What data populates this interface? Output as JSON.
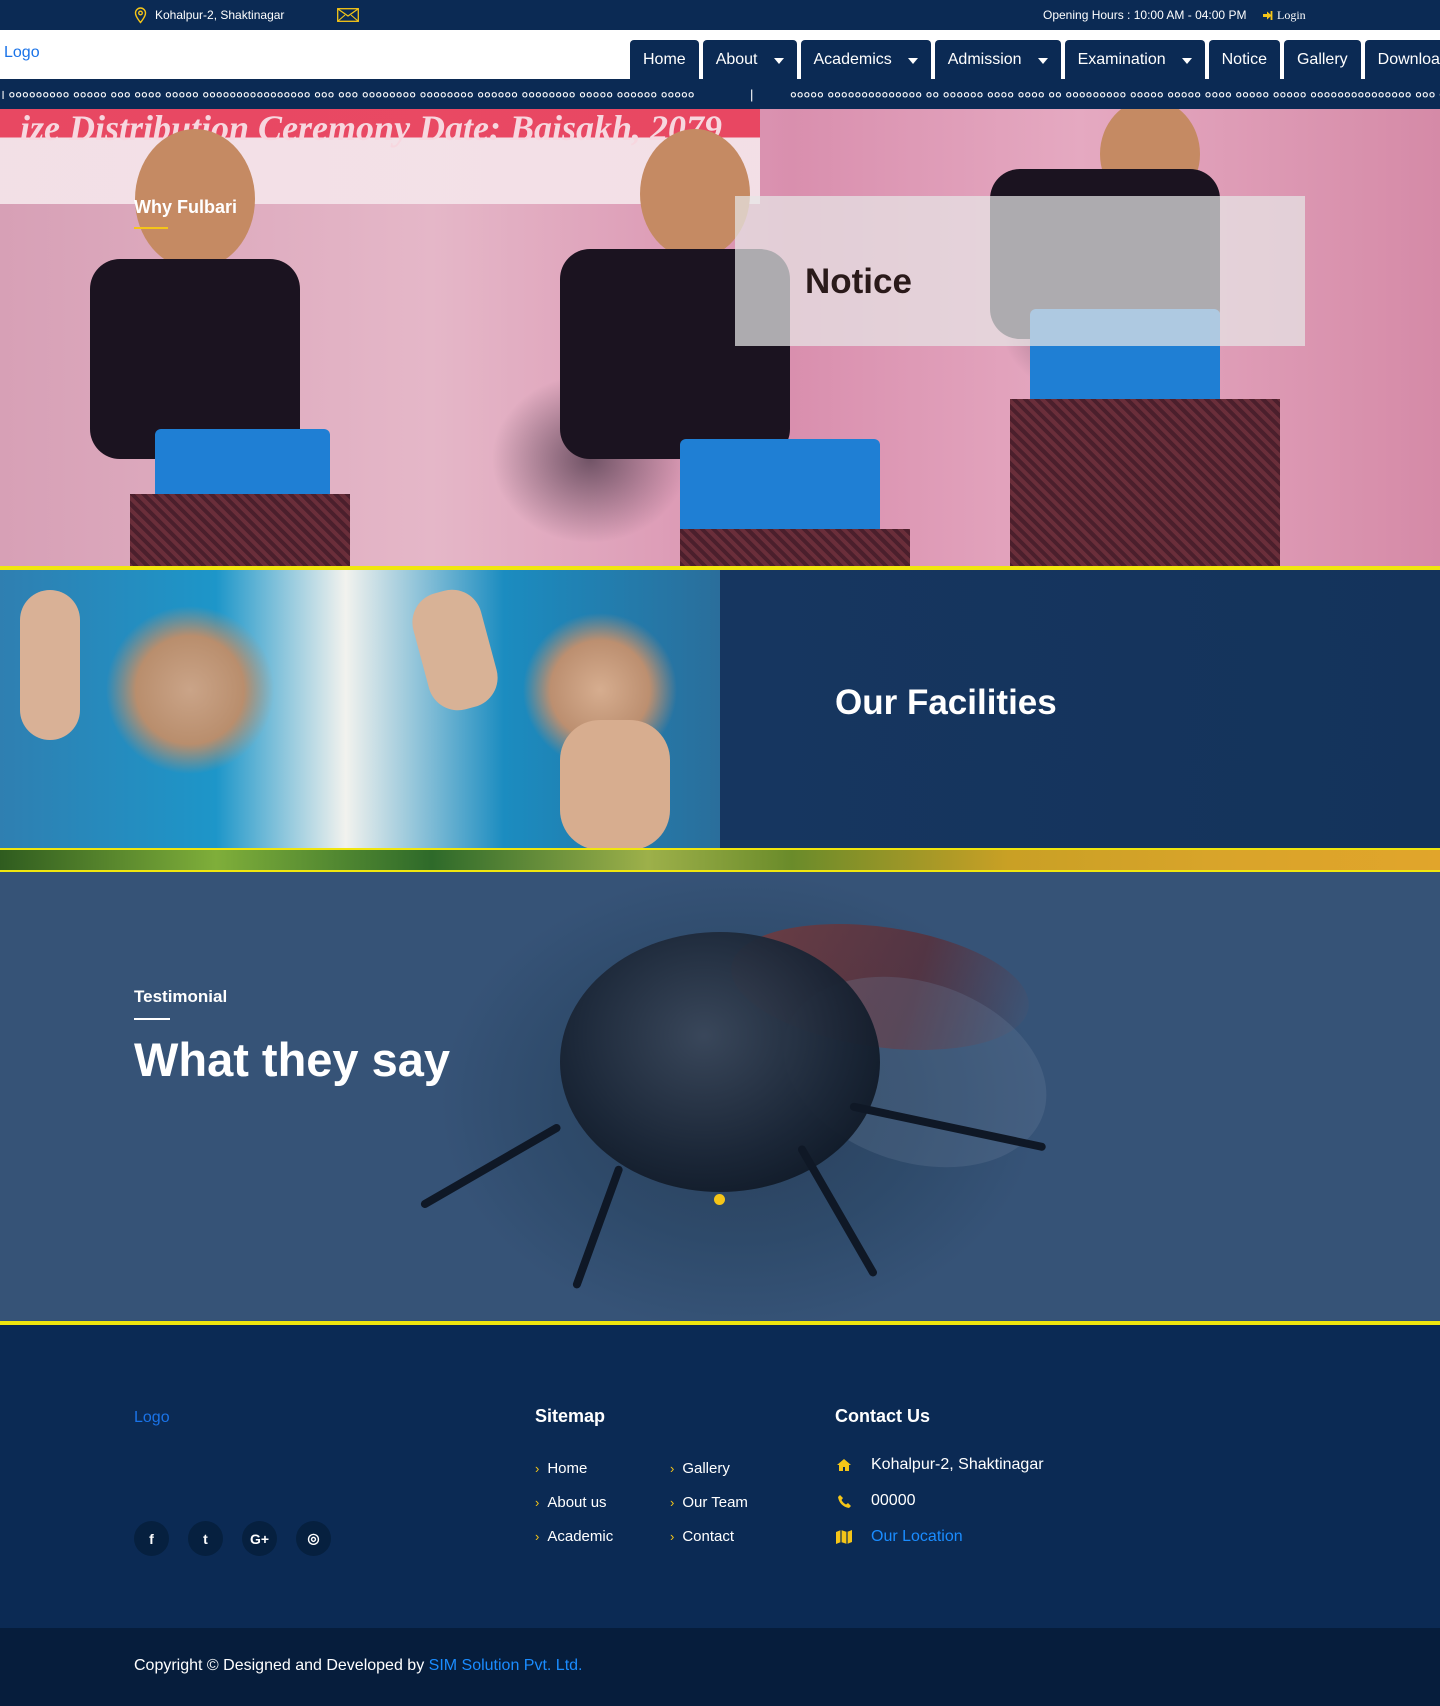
{
  "topbar": {
    "address": "Kohalpur-2, Shaktinagar",
    "hours": "Opening Hours : 10:00 AM - 04:00 PM",
    "login": "Login"
  },
  "header": {
    "logo_alt": "Logo",
    "nav": [
      {
        "label": "Home",
        "dropdown": false
      },
      {
        "label": "About",
        "dropdown": true
      },
      {
        "label": "Academics",
        "dropdown": true
      },
      {
        "label": "Admission",
        "dropdown": true
      },
      {
        "label": "Examination",
        "dropdown": true
      },
      {
        "label": "Notice",
        "dropdown": false
      },
      {
        "label": "Gallery",
        "dropdown": false
      },
      {
        "label": "Downloads",
        "dropdown": false
      }
    ]
  },
  "ticker": {
    "text_left": "। ००००००००० ००००० ००० ०००० ००००० ०००००००००००००००० ००० ००० ०००००००० ०००००००० ०००००० ०००००००० ००००० ०००००० ०००००",
    "separator": "|",
    "text_right": "००००० ०००००००००००००० ०० ०००००० ०००० ०००० ०० ००००००००० ००००० ००००० ०००० ००००० ००००० ००००००००००००००० ००० ००० ००"
  },
  "hero": {
    "banner_text": "ize Distribution Ceremony  Date: Baisakh, 2079",
    "why_label": "Why Fulbari",
    "notice_title": "Notice"
  },
  "facilities": {
    "title": "Our Facilities"
  },
  "testimonial": {
    "label": "Testimonial",
    "title": "What they say"
  },
  "footer": {
    "logo_alt": "Logo",
    "social": [
      {
        "icon": "facebook-icon",
        "glyph": "f"
      },
      {
        "icon": "twitter-icon",
        "glyph": "t"
      },
      {
        "icon": "google-plus-icon",
        "glyph": "G+"
      },
      {
        "icon": "instagram-icon",
        "glyph": "◎"
      }
    ],
    "sitemap_title": "Sitemap",
    "sitemap_col1": [
      "Home",
      "About us",
      "Academic"
    ],
    "sitemap_col2": [
      "Gallery",
      "Our Team",
      "Contact"
    ],
    "contact_title": "Contact Us",
    "contact": {
      "address": "Kohalpur-2, Shaktinagar",
      "phone": "00000",
      "location": "Our Location"
    }
  },
  "bottom": {
    "copyright_prefix": "Copyright © Designed and Developed by",
    "company": "SIM Solution Pvt. Ltd."
  },
  "colors": {
    "navy": "#0b2a54",
    "accent_yellow": "#f5c518",
    "divider_yellow": "#f0e60e",
    "link_blue": "#1a8cff"
  }
}
